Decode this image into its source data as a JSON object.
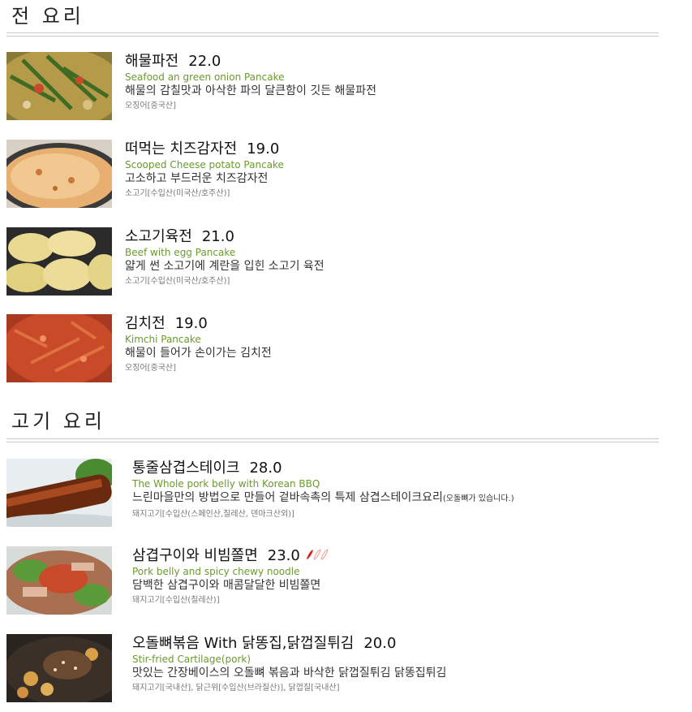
{
  "sections": [
    {
      "title": "전 요리",
      "items": [
        {
          "name": "해물파전",
          "price": "22.0",
          "english": "Seafood an green onion Pancake",
          "description": "해물의 감칠맛과 아삭한 파의 달큰함이 깃든 해물파전",
          "note": "",
          "origin": "오징어[중국산]"
        },
        {
          "name": "떠먹는 치즈감자전",
          "price": "19.0",
          "english": "Scooped Cheese potato Pancake",
          "description": "고소하고 부드러운 치즈감자전",
          "note": "",
          "origin": "소고기[수입산(미국산/호주산)]"
        },
        {
          "name": "소고기육전",
          "price": "21.0",
          "english": "Beef with egg Pancake",
          "description": "얇게 썬 소고기에 계란을 입힌 소고기 육전",
          "note": "",
          "origin": "소고기[수입산(미국산/호주산)]"
        },
        {
          "name": "김치전",
          "price": "19.0",
          "english": "Kimchi Pancake",
          "description": "해물이 들어가 손이가는 김치전",
          "note": "",
          "origin": "오징어[중국산]"
        }
      ]
    },
    {
      "title": "고기 요리",
      "items": [
        {
          "name": "통줄삼겹스테이크",
          "price": "28.0",
          "english": "The Whole pork belly with Korean BBQ",
          "description": "느린마을만의 방법으로 만들어 겉바속촉의 특제 삼겹스테이크요리",
          "note": "(오돌뼈가 있습니다.)",
          "origin": "돼지고기[수입산(스페인산,칠레산, 덴마크산외)]"
        },
        {
          "name": "삼겹구이와 비빔쫄면",
          "price": "23.0",
          "english": "Pork belly and spicy chewy noodle",
          "description": "담백한 삼겹구이와 매콤달달한 비빔쫄면",
          "note": "",
          "origin": "돼지고기[수입산(칠레산)]",
          "spicy_level": 1,
          "spicy_max": 3
        },
        {
          "name": "오돌뼈볶음 With 닭똥집,닭껍질튀김",
          "price": "20.0",
          "english": "Stir-fried Cartilage(pork)",
          "description": "맛있는 간장베이스의 오돌뼈 볶음과 바삭한 닭껍질튀김 닭똥집튀김",
          "note": "",
          "origin": "돼지고기[국내산], 닭근위[수입산(브라질산)], 닭껍질[국내산]"
        }
      ]
    }
  ],
  "colors": {
    "english_text": "#6a9a2e",
    "rule": "#c8c8c8",
    "pepper_red": "#d8231c",
    "pepper_outline": "#e8a09a"
  }
}
